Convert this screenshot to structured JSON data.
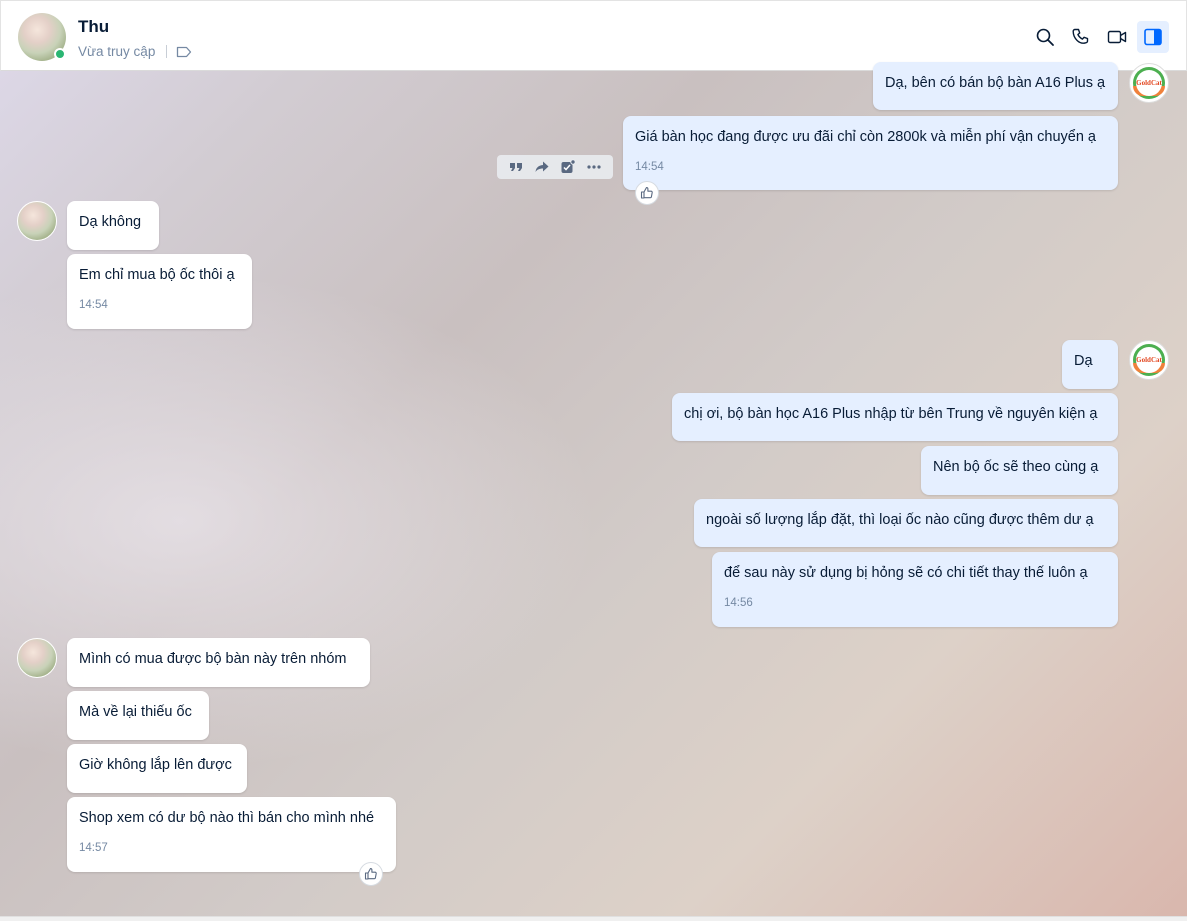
{
  "header": {
    "contact_name": "Thu",
    "status": "Vừa truy cập",
    "icons": [
      "search-icon",
      "phone-icon",
      "video-icon",
      "sidebar-toggle-icon",
      "tag-icon"
    ]
  },
  "messages": {
    "m1": "Dạ, bên có bán bộ bàn A16 Plus ạ",
    "m2": "Giá bàn học đang được ưu đãi chỉ còn 2800k và miễn phí vận chuyển ạ",
    "m2_time": "14:54",
    "m3": "Dạ không",
    "m4": "Em chỉ mua bộ ốc thôi ạ",
    "m4_time": "14:54",
    "m5": "Dạ",
    "m6": "chị ơi, bộ bàn học A16 Plus nhập từ bên Trung về nguyên kiện ạ",
    "m7": "Nên bộ ốc sẽ theo cùng ạ",
    "m8": "ngoài số lượng lắp đặt, thì loại ốc nào cũng được thêm dư ạ",
    "m9": "để sau này sử dụng bị hỏng sẽ có  chi tiết thay thế luôn ạ",
    "m9_time": "14:56",
    "m10": "Mình có mua được bộ bàn này trên nhóm",
    "m11": "Mà về lại thiếu ốc",
    "m12": "Giờ không lắp lên được",
    "m13": "Shop xem có dư bộ nào thì bán cho mình nhé",
    "m13_time": "14:57"
  },
  "shop_logo_text": "GoldCat",
  "colors": {
    "outgoing_bubble": "#e5efff",
    "incoming_bubble": "#ffffff",
    "online": "#2bb673",
    "accent": "#0068ff"
  }
}
